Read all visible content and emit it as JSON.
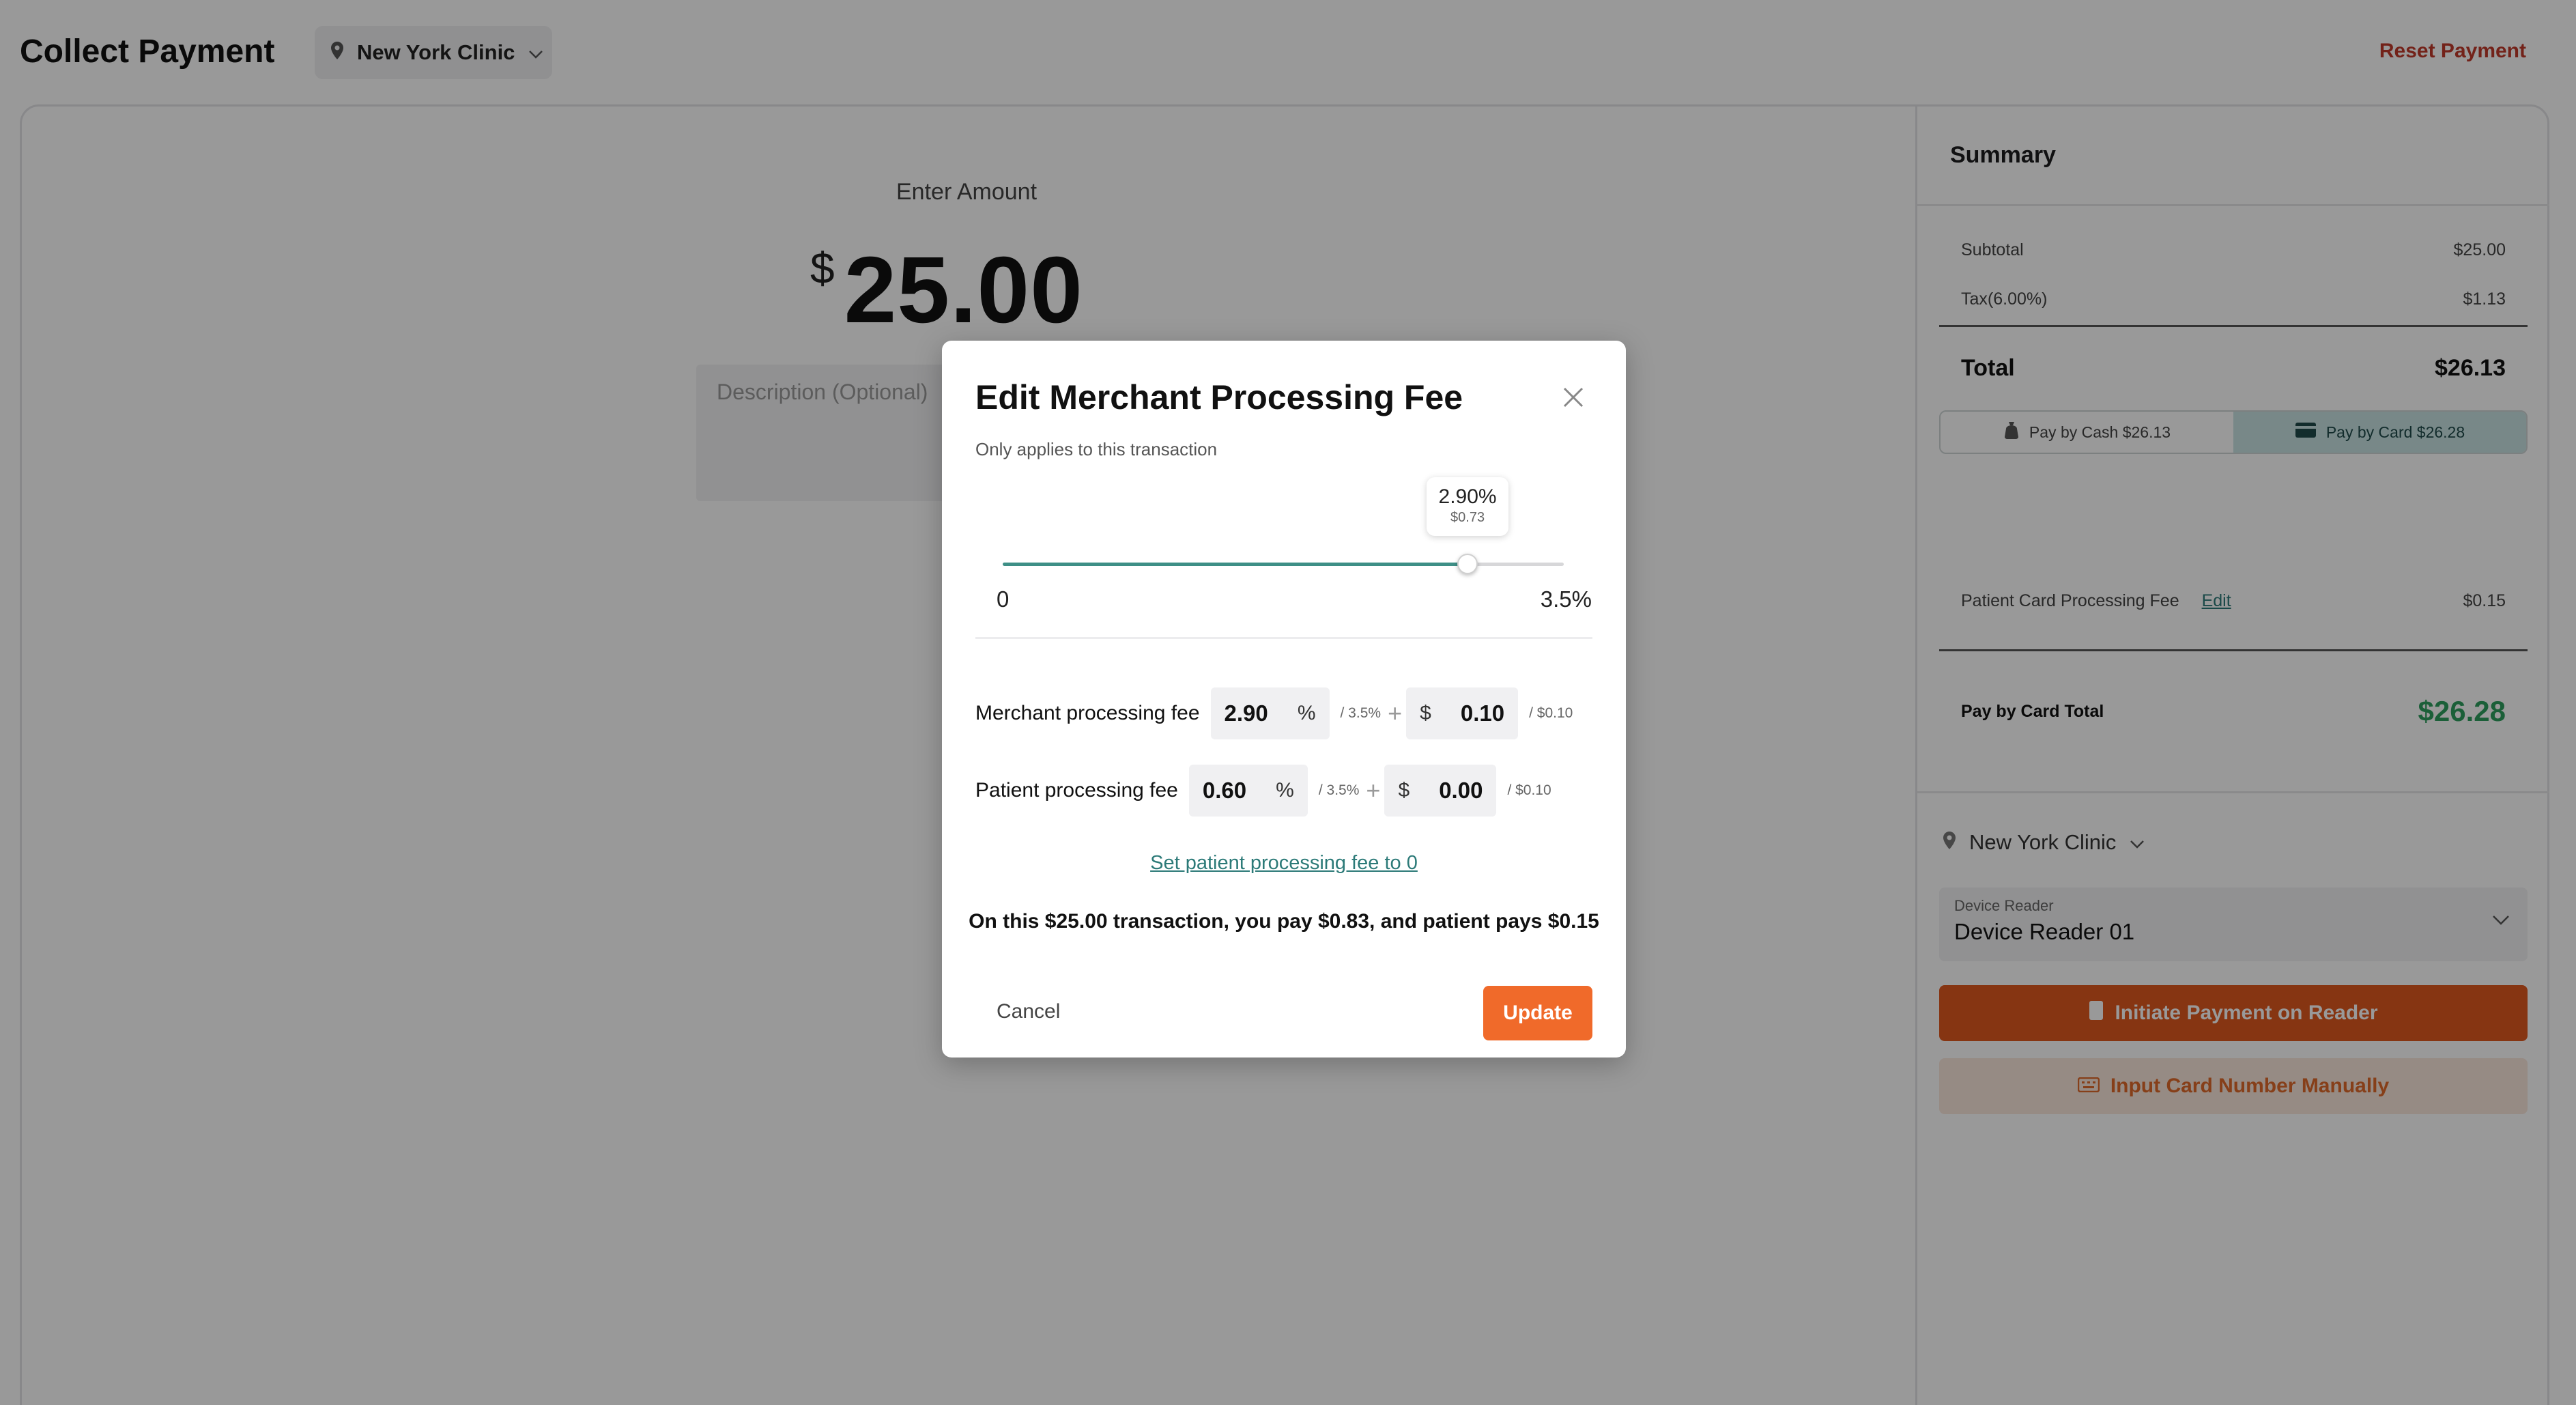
{
  "header": {
    "title": "Collect Payment",
    "clinic": "New York Clinic",
    "reset": "Reset Payment"
  },
  "amount_entry": {
    "label": "Enter Amount",
    "currency": "$",
    "value": "25.00",
    "description_placeholder": "Description (Optional)"
  },
  "summary": {
    "title": "Summary",
    "subtotal_label": "Subtotal",
    "subtotal_value": "$25.00",
    "tax_label": "Tax(6.00%)",
    "tax_value": "$1.13",
    "total_label": "Total",
    "total_value": "$26.13",
    "pay_cash": "Pay by Cash $26.13",
    "pay_card": "Pay by Card $26.28",
    "selected_method": "card",
    "patient_fee_label": "Patient Card Processing Fee",
    "patient_fee_edit": "Edit",
    "patient_fee_value": "$0.15",
    "card_total_label": "Pay by Card Total",
    "card_total_value": "$26.28",
    "clinic": "New York Clinic",
    "device_reader_label": "Device Reader",
    "device_reader_value": "Device Reader 01",
    "initiate_button": "Initiate Payment on Reader",
    "manual_button": "Input Card Number Manually"
  },
  "modal": {
    "title": "Edit Merchant Processing Fee",
    "subtitle": "Only applies to this transaction",
    "slider": {
      "min_label": "0",
      "max_label": "3.5%",
      "value_percent": 2.9,
      "max_percent": 3.5,
      "tooltip_pct": "2.90%",
      "tooltip_amt": "$0.73"
    },
    "merchant_fee": {
      "label": "Merchant processing fee",
      "pct_value": "2.90",
      "pct_unit": "%",
      "pct_max": "/ 3.5%",
      "flat_currency": "$",
      "flat_value": "0.10",
      "flat_max": "/ $0.10"
    },
    "patient_fee": {
      "label": "Patient processing fee",
      "pct_value": "0.60",
      "pct_unit": "%",
      "pct_max": "/ 3.5%",
      "flat_currency": "$",
      "flat_value": "0.00",
      "flat_max": "/ $0.10"
    },
    "plus": "+",
    "set_zero_link": "Set patient processing fee to 0",
    "summary_text": "On this $25.00 transaction, you pay $0.83, and patient pays $0.15",
    "cancel": "Cancel",
    "update": "Update"
  },
  "colors": {
    "accent_teal": "#3e8f86",
    "accent_orange": "#f06a2a",
    "initiate_orange": "#e0591f",
    "total_green": "#2e9f5e",
    "reset_red": "#c0392b"
  },
  "icons": [
    "location-pin-icon",
    "chevron-down-icon",
    "close-icon",
    "cash-bag-icon",
    "credit-card-icon",
    "card-reader-icon",
    "keyboard-icon"
  ]
}
